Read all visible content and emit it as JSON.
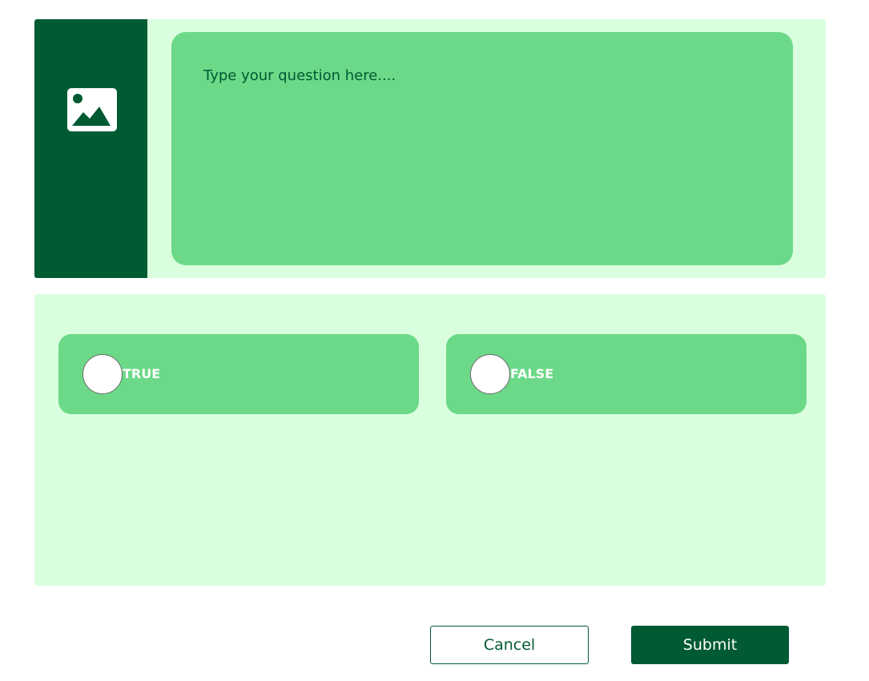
{
  "colors": {
    "dark_green": "#005a32",
    "medium_green": "#6cd988",
    "light_green": "#d9ffdf",
    "white": "#ffffff"
  },
  "question": {
    "media_icon": "image-icon",
    "input_value": "",
    "input_placeholder": "Type your question here...."
  },
  "answers": {
    "options": [
      {
        "label": "TRUE",
        "selected": false
      },
      {
        "label": "FALSE",
        "selected": false
      }
    ]
  },
  "actions": {
    "cancel_label": "Cancel",
    "submit_label": "Submit"
  }
}
